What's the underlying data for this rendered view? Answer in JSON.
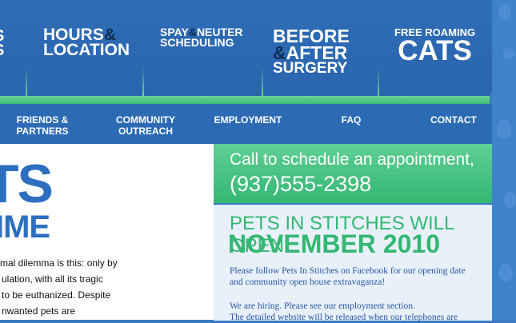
{
  "top_nav": {
    "partial": {
      "line1": "S",
      "line2": "S"
    },
    "hours": {
      "word1": "HOURS",
      "amp": "&",
      "word2": "LOCATION"
    },
    "spay": {
      "word1": "SPAY",
      "amp": "&",
      "word2": "NEUTER",
      "line2": "SCHEDULING"
    },
    "before": {
      "line1": "BEFORE",
      "amp": "&",
      "line2": "AFTER",
      "line3": "SURGERY"
    },
    "cats": {
      "line1": "FREE ROAMING",
      "line2": "CATS"
    }
  },
  "sub_nav": [
    {
      "line1": "FRIENDS &",
      "line2": "PARTNERS"
    },
    {
      "line1": "COMMUNITY",
      "line2": "OUTREACH"
    },
    {
      "line1": "EMPLOYMENT",
      "line2": ""
    },
    {
      "line1": "FAQ",
      "line2": ""
    },
    {
      "line1": "CONTACT",
      "line2": ""
    }
  ],
  "main": {
    "headline1": "TS",
    "headline2": "IME",
    "body_lines": [
      "mal dilemma is this: only by",
      "ulation, with all its tragic",
      "to be euthanized. Despite",
      "nwanted pets are"
    ]
  },
  "sidebar": {
    "call_line1": "Call to schedule an appointment,",
    "call_phone": "(937)555-2398",
    "open_line1": "PETS IN STITCHES WILL OPEN",
    "open_line2": "NOVEMBER 2010",
    "para1": [
      "Please follow Pets In Stitches on Facebook for our opening date",
      "and community open house extravaganza!"
    ],
    "para2": [
      "We are hiring. Please see our employment section.",
      "The detailed website will be released when our telephones are"
    ]
  },
  "colors": {
    "nav_blue": "#2f6db8",
    "green": "#34b773",
    "dark_amp": "#0d2d55",
    "headline_blue": "#2d6fbf"
  }
}
